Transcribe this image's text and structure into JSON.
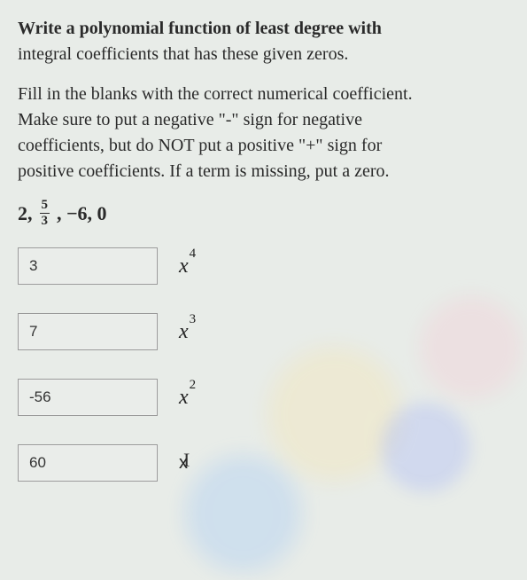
{
  "question": {
    "line1": "Write a polynomial function of least degree with",
    "line2": "integral coefficients that has these given zeros."
  },
  "instructions": {
    "line1": "Fill in the blanks with the correct numerical coefficient.",
    "line2": "Make sure to put a negative \"-\" sign for negative",
    "line3": "coefficients, but do NOT put a  positive \"+\" sign for",
    "line4": "positive coefficients. If a term is missing, put a zero."
  },
  "zeros": {
    "prefix": "2, ",
    "frac_num": "5",
    "frac_den": "3",
    "suffix": ", −6, 0"
  },
  "rows": [
    {
      "value": "3",
      "term_base": "x",
      "term_exp": "4"
    },
    {
      "value": "7",
      "term_base": "x",
      "term_exp": "3"
    },
    {
      "value": "-56",
      "term_base": "x",
      "term_exp": "2"
    },
    {
      "value": "60",
      "term_base": "x",
      "term_exp": ""
    }
  ],
  "cursor_glyph": "I"
}
